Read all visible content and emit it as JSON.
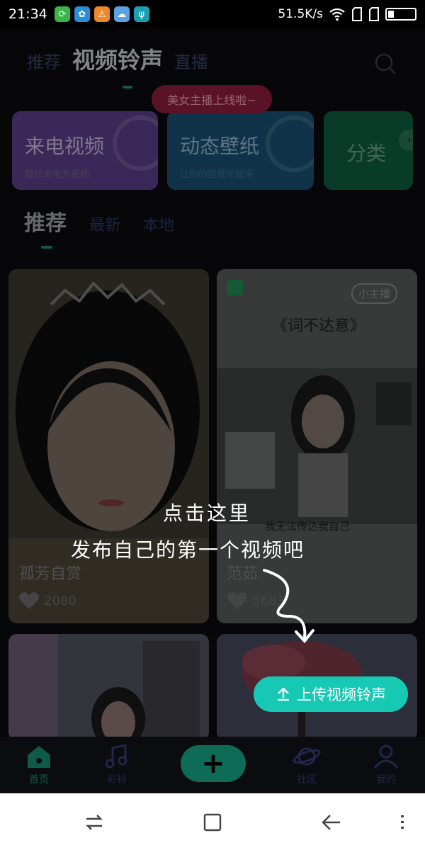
{
  "status_bar": {
    "time": "21:34",
    "speed": "51.5K/s"
  },
  "top_tabs": {
    "items": [
      "推荐",
      "视频铃声",
      "直播"
    ],
    "active": "视频铃声"
  },
  "promo": {
    "text": "美女主播上线啦~"
  },
  "categories": [
    {
      "title": "来电视频",
      "subtitle": "酷炫来电秀视频"
    },
    {
      "title": "动态壁纸",
      "subtitle": "让你的壁纸动起来"
    },
    {
      "title": "分类",
      "subtitle": ""
    }
  ],
  "sub_tabs": {
    "items": [
      "推荐",
      "最新",
      "本地"
    ],
    "active": "推荐"
  },
  "videos": [
    {
      "name": "孤芳自赏",
      "likes": "2080"
    },
    {
      "name": "范茹",
      "likes": "5683",
      "badge": "小主播",
      "song": "《词不达意》",
      "caption": "我无法传达我自己"
    },
    {
      "name": "",
      "likes": ""
    },
    {
      "name": "",
      "likes": ""
    }
  ],
  "hint": {
    "line1": "点击这里",
    "line2": "发布自己的第一个视频吧"
  },
  "upload_button": {
    "label": "上传视频铃声"
  },
  "bottom_nav": {
    "items": [
      {
        "label": "首页",
        "icon": "home-icon"
      },
      {
        "label": "彩铃",
        "icon": "music-note-icon"
      },
      {
        "label": "社区",
        "icon": "planet-icon"
      },
      {
        "label": "我的",
        "icon": "user-icon"
      }
    ],
    "add_label": "+"
  },
  "colors": {
    "accent": "#17c9b4",
    "card_purple": "#6a4a9c",
    "card_blue": "#1e6f9c",
    "card_green": "#1f8a55",
    "promo": "#8a1e3b"
  }
}
